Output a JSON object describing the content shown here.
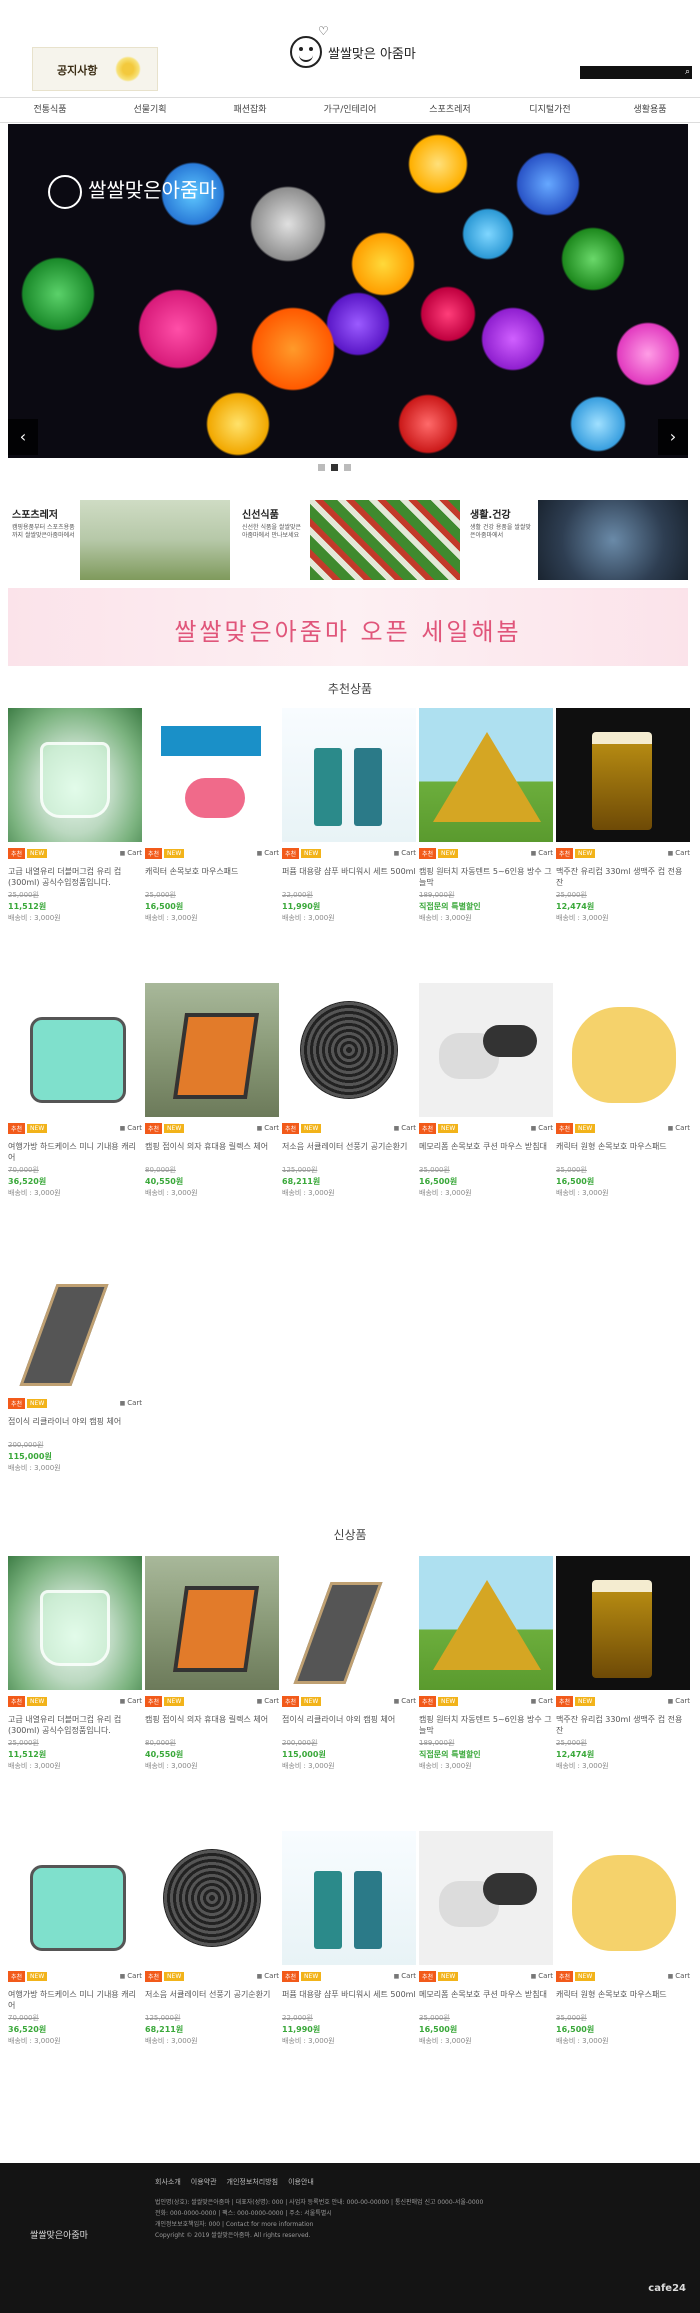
{
  "header": {
    "notice_text": "공지사항",
    "logo_text": "쌀쌀맞은 아줌마",
    "search_placeholder": ""
  },
  "nav": [
    "전통식품",
    "선물기획",
    "패션잡화",
    "가구/인테리어",
    "스포츠레저",
    "디지털가전",
    "생활용품"
  ],
  "hero": {
    "logo_text": "쌀쌀맞은아줌마",
    "prev": "‹",
    "next": "›"
  },
  "categories": [
    {
      "title": "스포츠레저",
      "desc": "캠핑용품부터 스포츠용품까지 쌀쌀맞은아줌마에서"
    },
    {
      "title": "신선식품",
      "desc": "신선한 식품을 쌀쌀맞은아줌마에서 만나보세요"
    },
    {
      "title": "생활.건강",
      "desc": "생활 건강 용품을 쌀쌀맞은아줌마에서"
    }
  ],
  "sale_banner": "쌀쌀맞은아줌마 오픈 세일해봄",
  "sections": {
    "recommended": "추천상품",
    "new": "신상품"
  },
  "cart_label": "Cart",
  "recommended": [
    {
      "img": "cup",
      "badges": [
        "추천",
        "NEW"
      ],
      "name": "고급 내열유리 더블머그컵 유리 컵 (300ml) 공식수입정품입니다.",
      "orig": "25,000원",
      "price": "11,512원",
      "ship": "배송비 : 3,000원"
    },
    {
      "img": "pad",
      "badges": [
        "추천",
        "NEW"
      ],
      "name": "캐릭터 손목보호 마우스패드",
      "orig": "25,000원",
      "price": "16,500원",
      "ship": "배송비 : 3,000원"
    },
    {
      "img": "perfume",
      "badges": [
        "추천",
        "NEW"
      ],
      "name": "퍼퓸 대용량 샴푸 바디워시 세트 500ml",
      "orig": "22,000원",
      "price": "11,990원",
      "ship": "배송비 : 3,000원"
    },
    {
      "img": "tent",
      "badges": [
        "추천",
        "NEW"
      ],
      "name": "캠핑 원터치 자동텐트 5~6인용 방수 그늘막",
      "orig": "189,000원",
      "price": "직접문의 특별할인",
      "ship": "배송비 : 3,000원"
    },
    {
      "img": "beer",
      "badges": [
        "추천",
        "NEW"
      ],
      "name": "맥주잔 유리컵 330ml 생맥주 컵 전용 잔",
      "orig": "25,000원",
      "price": "12,474원",
      "ship": "배송비 : 3,000원"
    },
    {
      "img": "case",
      "badges": [
        "추천",
        "NEW"
      ],
      "name": "여행가방 하드케이스 미니 기내용 캐리어",
      "orig": "70,000원",
      "price": "36,520원",
      "ship": "배송비 : 3,000원"
    },
    {
      "img": "chair",
      "badges": [
        "추천",
        "NEW"
      ],
      "name": "캠핑 접이식 의자 휴대용 릴렉스 체어",
      "orig": "80,000원",
      "price": "40,550원",
      "ship": "배송비 : 3,000원"
    },
    {
      "img": "fan",
      "badges": [
        "추천",
        "NEW"
      ],
      "name": "저소음 서큘레이터 선풍기 공기순환기",
      "orig": "125,000원",
      "price": "68,211원",
      "ship": "배송비 : 3,000원"
    },
    {
      "img": "pillow",
      "badges": [
        "추천",
        "NEW"
      ],
      "name": "메모리폼 손목보호 쿠션 마우스 받침대",
      "orig": "35,000원",
      "price": "16,500원",
      "ship": "배송비 : 3,000원"
    },
    {
      "img": "mousepad",
      "badges": [
        "추천",
        "NEW"
      ],
      "name": "캐릭터 원형 손목보호 마우스패드",
      "orig": "35,000원",
      "price": "16,500원",
      "ship": "배송비 : 3,000원"
    },
    {
      "img": "lounger",
      "badges": [
        "추천",
        "NEW"
      ],
      "name": "접이식 리클라이너 야외 캠핑 체어",
      "orig": "200,000원",
      "price": "115,000원",
      "ship": "배송비 : 3,000원"
    }
  ],
  "new_items": [
    {
      "img": "cup",
      "badges": [
        "추천",
        "NEW"
      ],
      "name": "고급 내열유리 더블머그컵 유리 컵 (300ml) 공식수입정품입니다.",
      "orig": "25,000원",
      "price": "11,512원",
      "ship": "배송비 : 3,000원"
    },
    {
      "img": "chair",
      "badges": [
        "추천",
        "NEW"
      ],
      "name": "캠핑 접이식 의자 휴대용 릴렉스 체어",
      "orig": "80,000원",
      "price": "40,550원",
      "ship": "배송비 : 3,000원"
    },
    {
      "img": "lounger",
      "badges": [
        "추천",
        "NEW"
      ],
      "name": "접이식 리클라이너 야외 캠핑 체어",
      "orig": "200,000원",
      "price": "115,000원",
      "ship": "배송비 : 3,000원"
    },
    {
      "img": "tent",
      "badges": [
        "추천",
        "NEW"
      ],
      "name": "캠핑 원터치 자동텐트 5~6인용 방수 그늘막",
      "orig": "189,000원",
      "price": "직접문의 특별할인",
      "ship": "배송비 : 3,000원"
    },
    {
      "img": "beer",
      "badges": [
        "추천",
        "NEW"
      ],
      "name": "맥주잔 유리컵 330ml 생맥주 컵 전용 잔",
      "orig": "25,000원",
      "price": "12,474원",
      "ship": "배송비 : 3,000원"
    },
    {
      "img": "case",
      "badges": [
        "추천",
        "NEW"
      ],
      "name": "여행가방 하드케이스 미니 기내용 캐리어",
      "orig": "70,000원",
      "price": "36,520원",
      "ship": "배송비 : 3,000원"
    },
    {
      "img": "fan",
      "badges": [
        "추천",
        "NEW"
      ],
      "name": "저소음 서큘레이터 선풍기 공기순환기",
      "orig": "125,000원",
      "price": "68,211원",
      "ship": "배송비 : 3,000원"
    },
    {
      "img": "perfume",
      "badges": [
        "추천",
        "NEW"
      ],
      "name": "퍼퓸 대용량 샴푸 바디워시 세트 500ml",
      "orig": "22,000원",
      "price": "11,990원",
      "ship": "배송비 : 3,000원"
    },
    {
      "img": "pillow",
      "badges": [
        "추천",
        "NEW"
      ],
      "name": "메모리폼 손목보호 쿠션 마우스 받침대",
      "orig": "35,000원",
      "price": "16,500원",
      "ship": "배송비 : 3,000원"
    },
    {
      "img": "mousepad",
      "badges": [
        "추천",
        "NEW"
      ],
      "name": "캐릭터 원형 손목보호 마우스패드",
      "orig": "35,000원",
      "price": "16,500원",
      "ship": "배송비 : 3,000원"
    }
  ],
  "footer": {
    "links": [
      "회사소개",
      "이용약관",
      "개인정보처리방침",
      "이용안내"
    ],
    "logo_text": "쌀쌀맞은아줌마",
    "info": [
      "법인명(상호): 쌀쌀맞은아줌마 | 대표자(성명): 000 | 사업자 등록번호 안내: 000-00-00000 | 통신판매업 신고 0000-서울-0000",
      "전화: 000-0000-0000 | 팩스: 000-0000-0000 | 주소: 서울특별시",
      "개인정보보호책임자: 000 | Contact for more information",
      "Copyright © 2019 쌀쌀맞은아줌마. All rights reserved."
    ],
    "powered": "cafe24"
  },
  "colors": {
    "price_green": "#3aa83a",
    "badge_red": "#f25a1a",
    "badge_yellow": "#f2b31a",
    "footer_bg": "#141414"
  }
}
